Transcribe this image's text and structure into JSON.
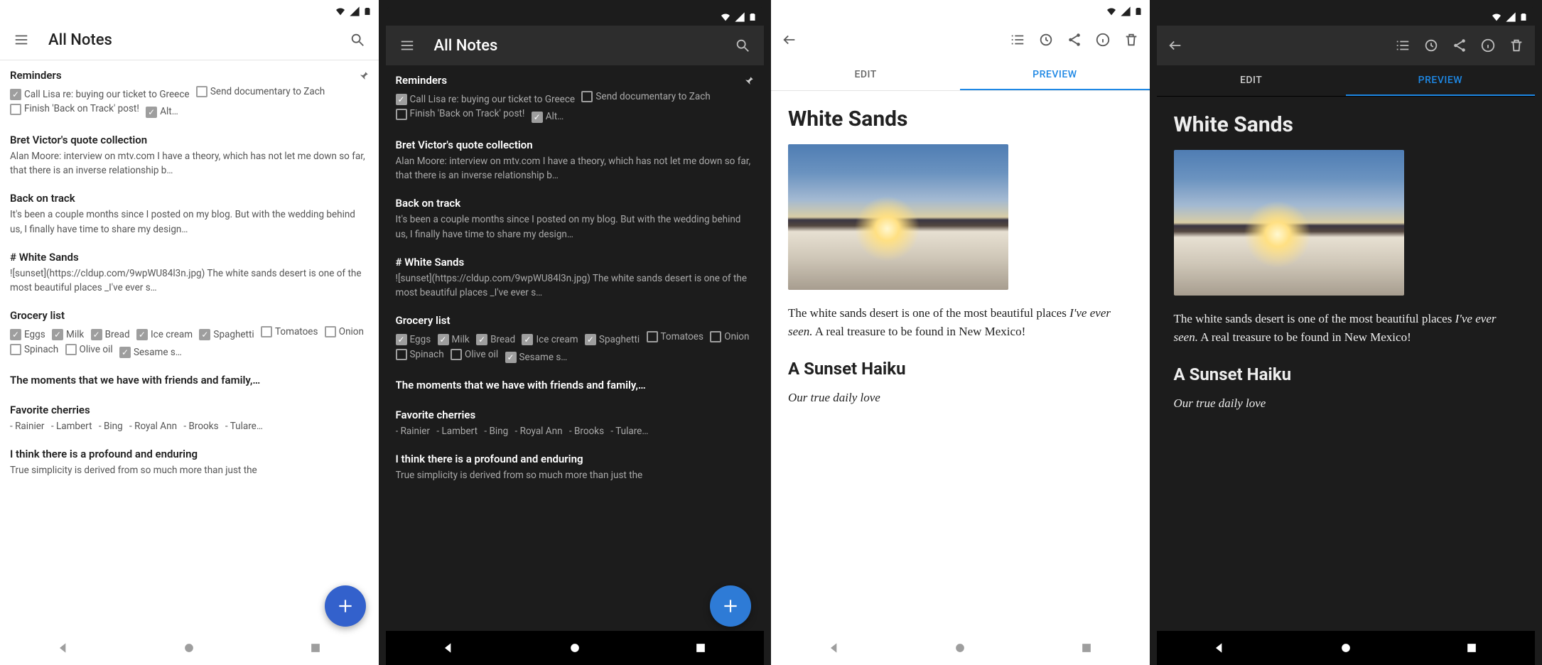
{
  "allNotesTitle": "All Notes",
  "notes": {
    "reminders": {
      "title": "Reminders",
      "items": [
        {
          "label": "Call Lisa re: buying our ticket to Greece",
          "checked": true
        },
        {
          "label": "Send documentary to Zach",
          "checked": false
        },
        {
          "label": "Finish 'Back on Track' post!",
          "checked": false
        },
        {
          "label": "Alt…",
          "checked": true
        }
      ]
    },
    "bret": {
      "title": "Bret Victor's quote collection",
      "body": "Alan Moore: interview on mtv.com I have a theory, which has not let me down so far, that there is an inverse relationship b…"
    },
    "back": {
      "title": "Back on track",
      "body": "It's been a couple months since I posted on my blog. But with the wedding behind us, I finally have time to share my design…"
    },
    "white": {
      "title": "# White Sands",
      "body": "![sunset](https://cldup.com/9wpWU84l3n.jpg) The white sands desert is one of the most beautiful places _I've ever s…"
    },
    "grocery": {
      "title": "Grocery list",
      "items": [
        {
          "label": "Eggs",
          "checked": true
        },
        {
          "label": "Milk",
          "checked": true
        },
        {
          "label": "Bread",
          "checked": true
        },
        {
          "label": "Ice cream",
          "checked": true
        },
        {
          "label": "Spaghetti",
          "checked": true
        },
        {
          "label": "Tomatoes",
          "checked": false
        },
        {
          "label": "Onion",
          "checked": false
        },
        {
          "label": "Spinach",
          "checked": false
        },
        {
          "label": "Olive oil",
          "checked": false
        },
        {
          "label": "Sesame s…",
          "checked": true
        }
      ]
    },
    "moments": {
      "title": "The moments that we have with friends and family,…"
    },
    "cherries": {
      "title": "Favorite cherries",
      "items": [
        "Rainier",
        "Lambert",
        "Bing",
        "Royal Ann",
        "Brooks",
        "Tulare…"
      ]
    },
    "profound": {
      "title": "I think there is a profound and enduring",
      "body": "True simplicity is derived from so much more than just the"
    }
  },
  "editor": {
    "tabs": {
      "edit": "EDIT",
      "preview": "PREVIEW"
    },
    "doc": {
      "h1": "White Sands",
      "p1a": "The white sands desert is one of the most beautiful places ",
      "p1em": "I've ever seen.",
      "p1b": " A real treasure to be found in New Mexico!",
      "h2": "A Sunset Haiku",
      "haiku1": "Our true daily love"
    }
  }
}
